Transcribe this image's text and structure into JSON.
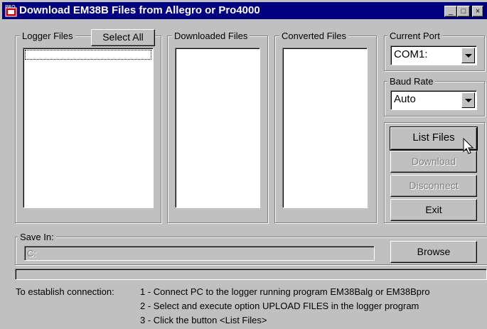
{
  "window": {
    "title": "Download EM38B Files from Allegro or Pro4000",
    "app_icon_text": "PRO",
    "controls": {
      "minimize": "_",
      "maximize": "□",
      "close": "×"
    }
  },
  "groups": {
    "logger_files": {
      "label": "Logger Files",
      "select_all_label": "Select All"
    },
    "downloaded_files": {
      "label": "Downloaded Files"
    },
    "converted_files": {
      "label": "Converted Files"
    },
    "current_port": {
      "label": "Current Port",
      "value": "COM1:"
    },
    "baud_rate": {
      "label": "Baud Rate",
      "value": "Auto"
    },
    "save_in": {
      "label": "Save In:",
      "path_placeholder": "C:",
      "browse_label": "Browse"
    }
  },
  "actions": {
    "list_files": "List Files",
    "download": "Download",
    "disconnect": "Disconnect",
    "exit": "Exit"
  },
  "instructions": {
    "heading": "To establish connection:",
    "steps": [
      "1  -  Connect PC to the logger running program EM38Balg or EM38Bpro",
      "2  -  Select and execute option UPLOAD FILES in the logger program",
      "3  -  Click the button <List Files>"
    ]
  },
  "colors": {
    "title_bar": "#000080",
    "face": "#c0c0c0",
    "list_bg": "#ffffff"
  }
}
